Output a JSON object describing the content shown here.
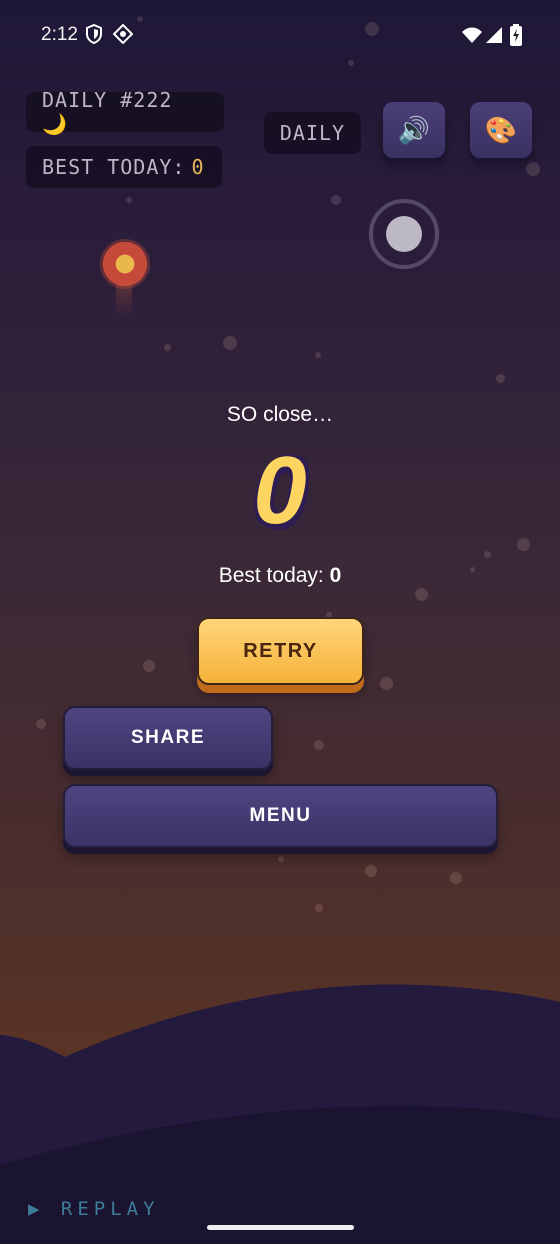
{
  "status_bar": {
    "time": "2:12"
  },
  "header": {
    "daily_badge": "DAILY #222 🌙",
    "best_label": "BEST TODAY:",
    "best_value": "0",
    "mode_label": "DAILY",
    "sound_icon": "🔊",
    "theme_icon": "🎨"
  },
  "result": {
    "message": "SO close…",
    "score": "0",
    "best_label": "Best today:",
    "best_value": "0"
  },
  "buttons": {
    "retry": "RETRY",
    "share": "SHARE",
    "menu": "MENU"
  },
  "footer": {
    "replay": "▶ REPLAY"
  },
  "colors": {
    "gold": "#f5b23a",
    "purple": "#3b3266",
    "hill": "#1e1736"
  }
}
